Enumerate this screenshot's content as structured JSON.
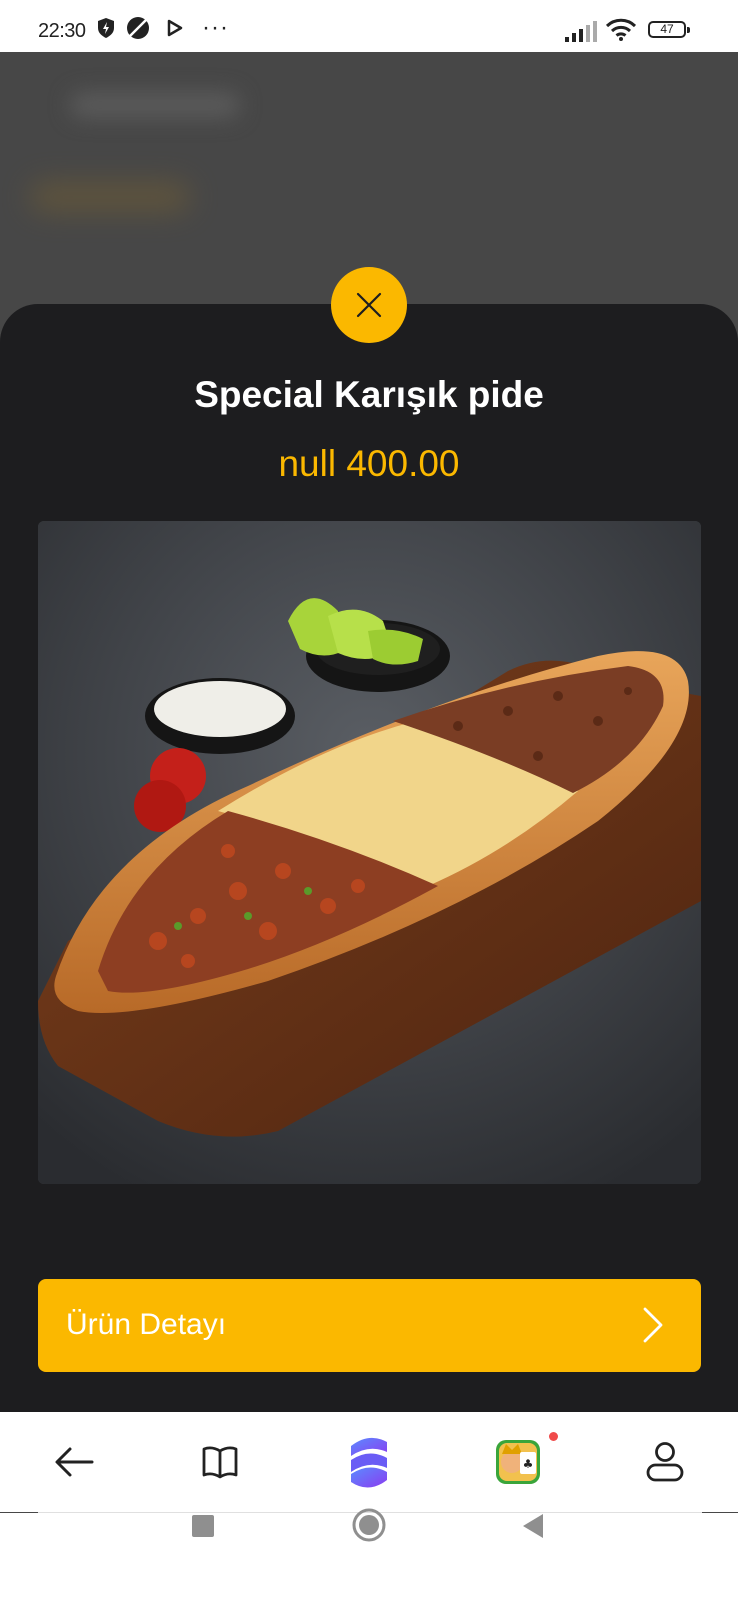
{
  "status_bar": {
    "time": "22:30",
    "dots": "···",
    "battery": "47",
    "icons": [
      "shield-bolt-icon",
      "no-sign-icon",
      "play-icon",
      "signal-icon",
      "wifi-icon",
      "battery-icon"
    ]
  },
  "modal": {
    "close_icon": "close-icon",
    "title": "Special Karışık pide",
    "price": "null 400.00",
    "image_alt": "pide-photo",
    "detail_button_label": "Ürün Detayı",
    "detail_button_icon": "chevron-right-icon"
  },
  "browser_nav": {
    "items": [
      "back-arrow-icon",
      "book-icon",
      "browser-logo-icon",
      "game-app-icon",
      "profile-icon"
    ],
    "game_badge": true
  },
  "system_nav": {
    "items": [
      "recents-square-icon",
      "home-circle-icon",
      "back-triangle-icon"
    ]
  },
  "colors": {
    "accent": "#fbb800",
    "sheet_background": "#1d1d1f",
    "overlay_background": "#474747",
    "title_text": "#ffffff"
  }
}
